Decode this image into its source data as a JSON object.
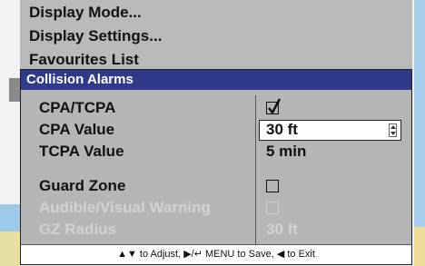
{
  "menu": {
    "items": [
      {
        "label": "Display Mode..."
      },
      {
        "label": "Display Settings..."
      },
      {
        "label": "Favourites List"
      }
    ]
  },
  "dialog": {
    "title": "Collision Alarms",
    "rows": [
      {
        "label": "CPA/TCPA",
        "value_type": "checkbox",
        "checked": true,
        "enabled": true
      },
      {
        "label": "CPA Value",
        "value": "30 ft",
        "value_type": "spinbox",
        "enabled": true
      },
      {
        "label": "TCPA Value",
        "value": "5 min",
        "value_type": "text",
        "enabled": true
      },
      {
        "label": "Guard Zone",
        "value_type": "checkbox",
        "checked": false,
        "enabled": true
      },
      {
        "label": "Audible/Visual Warning",
        "value_type": "checkbox",
        "checked": false,
        "enabled": false
      },
      {
        "label": "GZ Radius",
        "value": "30 ft",
        "value_type": "text",
        "enabled": false
      }
    ],
    "footer": "▲▼ to Adjust, ▶/↵ MENU to Save, ◀ to Exit"
  },
  "colors": {
    "title_bar": "#2f3a8a",
    "dialog_bg": "#b5b5b5",
    "disabled_text": "#d2d2d2"
  }
}
